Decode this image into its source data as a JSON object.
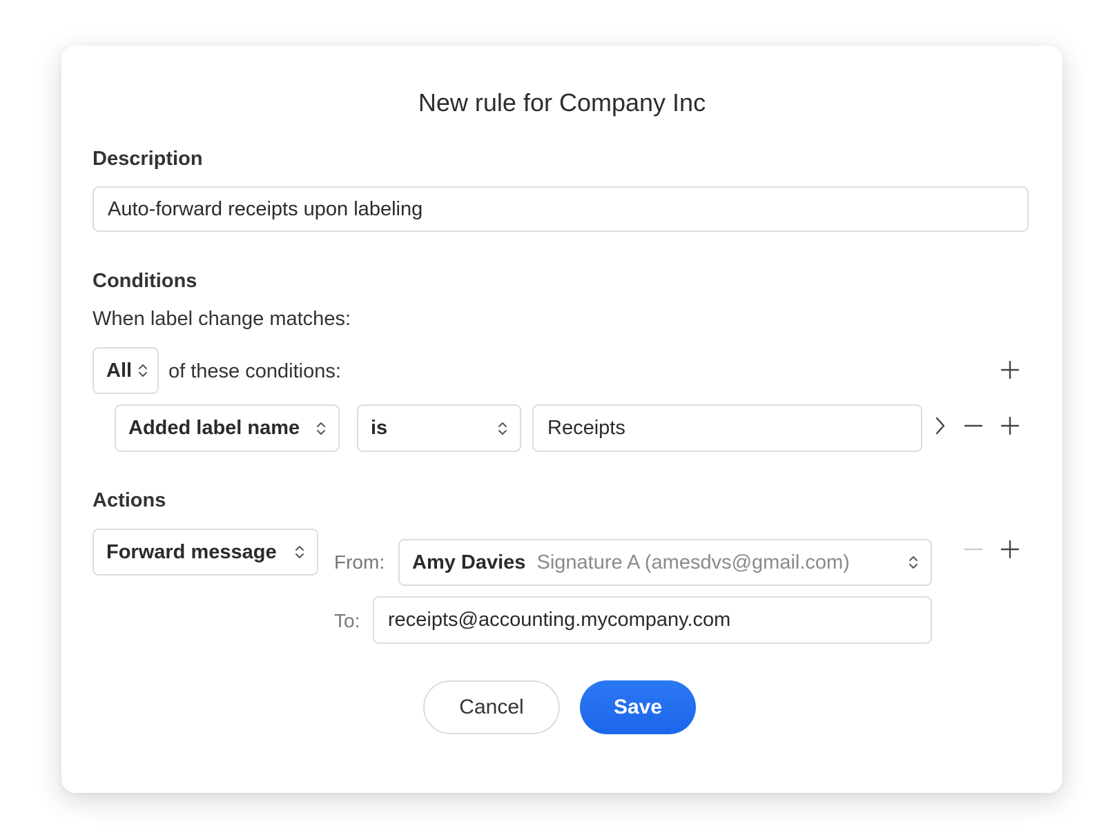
{
  "dialog": {
    "title": "New rule for Company Inc"
  },
  "description": {
    "label": "Description",
    "value": "Auto-forward receipts upon labeling"
  },
  "conditions": {
    "label": "Conditions",
    "intro": "When label change matches:",
    "match_mode": "All",
    "match_suffix": "of these conditions:",
    "rows": [
      {
        "field": "Added label name",
        "operator": "is",
        "value": "Receipts"
      }
    ]
  },
  "actions": {
    "label": "Actions",
    "rows": [
      {
        "action": "Forward message",
        "from_label": "From:",
        "from_name": "Amy Davies",
        "from_detail": "Signature A (amesdvs@gmail.com)",
        "to_label": "To:",
        "to_value": "receipts@accounting.mycompany.com"
      }
    ]
  },
  "buttons": {
    "cancel": "Cancel",
    "save": "Save"
  },
  "colors": {
    "accent": "#1e6ff0",
    "border": "#dcdcdc"
  }
}
